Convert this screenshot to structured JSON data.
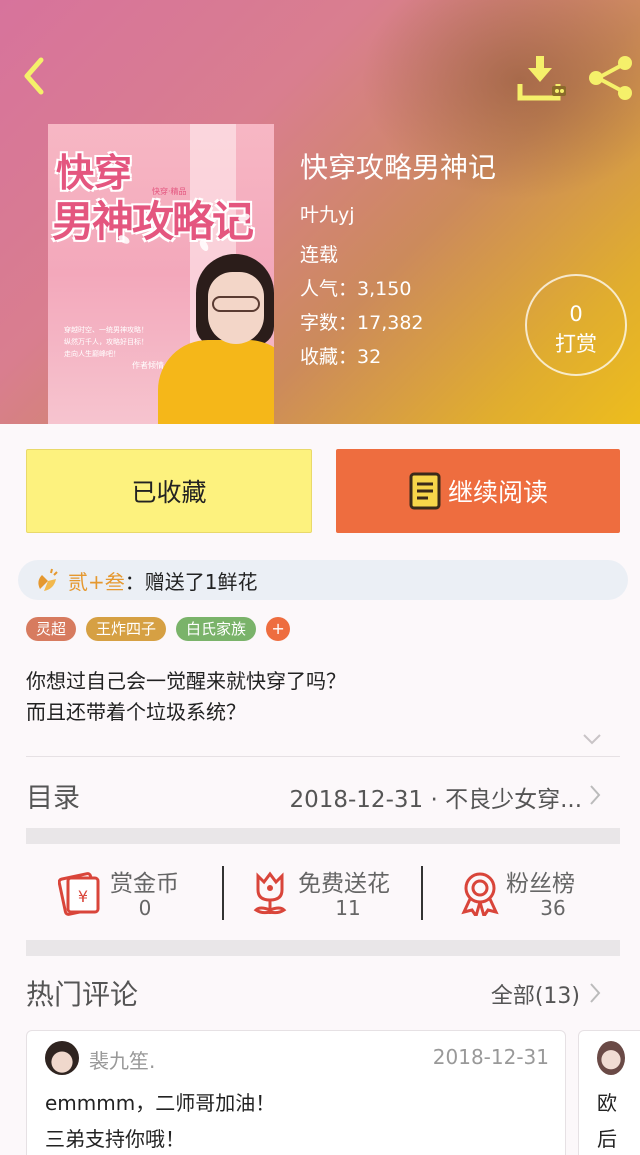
{
  "header": {
    "back_icon": "chevron-left-icon",
    "download_icon": "download-icon",
    "share_icon": "share-icon"
  },
  "cover": {
    "title_line1": "快穿",
    "title_line2": "男神攻略记",
    "tagline": "快穿·精品",
    "blurb": "穿越时空、一统男神攻略！",
    "blurb2": "纵然万千人，攻略好目标！",
    "blurb3": "走向人生巅峰吧！",
    "sign": "作者倾情——"
  },
  "book": {
    "title": "快穿攻略男神记",
    "author": "叶九yj",
    "status": "连载",
    "popularity_label": "人气：",
    "popularity": "3,150",
    "words_label": "字数：",
    "words": "17,382",
    "favorites_label": "收藏：",
    "favorites": "32"
  },
  "reward": {
    "count": "0",
    "label": "打赏"
  },
  "actions": {
    "favorite_label": "已收藏",
    "read_label": "继续阅读"
  },
  "gift": {
    "user": "贰+叁",
    "text": "：赠送了1鲜花"
  },
  "tags": [
    {
      "label": "灵超",
      "color": "#d77b5f"
    },
    {
      "label": "王炸四子",
      "color": "#d6a043"
    },
    {
      "label": "白氏家族",
      "color": "#7ab36a"
    },
    {
      "label": "+",
      "color": "#ee6d3f"
    }
  ],
  "intro": {
    "line1": "你想过自己会一觉醒来就快穿了吗？",
    "line2": "而且还带着个垃圾系统？"
  },
  "toc": {
    "label": "目录",
    "latest": "2018-12-31 · 不良少女穿..."
  },
  "stats": [
    {
      "name": "赏金币",
      "value": "0",
      "icon": "red-envelope-icon"
    },
    {
      "name": "免费送花",
      "value": "11",
      "icon": "flower-icon"
    },
    {
      "name": "粉丝榜",
      "value": "36",
      "icon": "medal-icon"
    }
  ],
  "comments_section": {
    "label": "热门评论",
    "all_label": "全部(13)"
  },
  "comments": [
    {
      "user": "裴九笙.",
      "date": "2018-12-31",
      "line1": "emmmm，二师哥加油！",
      "line2": "三弟支持你哦！"
    },
    {
      "line1": "欧",
      "line2": "后"
    }
  ],
  "colors": {
    "accent_orange": "#ee6d3f",
    "favorite_yellow": "#fdf27e",
    "gift_user": "#e5982f"
  }
}
